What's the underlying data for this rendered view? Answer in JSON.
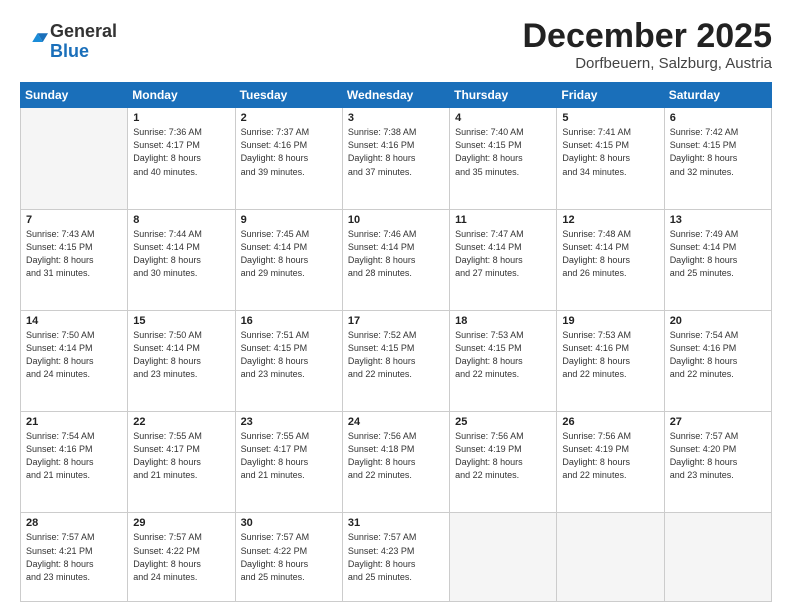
{
  "header": {
    "logo_general": "General",
    "logo_blue": "Blue",
    "month_title": "December 2025",
    "location": "Dorfbeuern, Salzburg, Austria"
  },
  "weekdays": [
    "Sunday",
    "Monday",
    "Tuesday",
    "Wednesday",
    "Thursday",
    "Friday",
    "Saturday"
  ],
  "weeks": [
    [
      {
        "num": "",
        "info": ""
      },
      {
        "num": "1",
        "info": "Sunrise: 7:36 AM\nSunset: 4:17 PM\nDaylight: 8 hours\nand 40 minutes."
      },
      {
        "num": "2",
        "info": "Sunrise: 7:37 AM\nSunset: 4:16 PM\nDaylight: 8 hours\nand 39 minutes."
      },
      {
        "num": "3",
        "info": "Sunrise: 7:38 AM\nSunset: 4:16 PM\nDaylight: 8 hours\nand 37 minutes."
      },
      {
        "num": "4",
        "info": "Sunrise: 7:40 AM\nSunset: 4:15 PM\nDaylight: 8 hours\nand 35 minutes."
      },
      {
        "num": "5",
        "info": "Sunrise: 7:41 AM\nSunset: 4:15 PM\nDaylight: 8 hours\nand 34 minutes."
      },
      {
        "num": "6",
        "info": "Sunrise: 7:42 AM\nSunset: 4:15 PM\nDaylight: 8 hours\nand 32 minutes."
      }
    ],
    [
      {
        "num": "7",
        "info": "Sunrise: 7:43 AM\nSunset: 4:15 PM\nDaylight: 8 hours\nand 31 minutes."
      },
      {
        "num": "8",
        "info": "Sunrise: 7:44 AM\nSunset: 4:14 PM\nDaylight: 8 hours\nand 30 minutes."
      },
      {
        "num": "9",
        "info": "Sunrise: 7:45 AM\nSunset: 4:14 PM\nDaylight: 8 hours\nand 29 minutes."
      },
      {
        "num": "10",
        "info": "Sunrise: 7:46 AM\nSunset: 4:14 PM\nDaylight: 8 hours\nand 28 minutes."
      },
      {
        "num": "11",
        "info": "Sunrise: 7:47 AM\nSunset: 4:14 PM\nDaylight: 8 hours\nand 27 minutes."
      },
      {
        "num": "12",
        "info": "Sunrise: 7:48 AM\nSunset: 4:14 PM\nDaylight: 8 hours\nand 26 minutes."
      },
      {
        "num": "13",
        "info": "Sunrise: 7:49 AM\nSunset: 4:14 PM\nDaylight: 8 hours\nand 25 minutes."
      }
    ],
    [
      {
        "num": "14",
        "info": "Sunrise: 7:50 AM\nSunset: 4:14 PM\nDaylight: 8 hours\nand 24 minutes."
      },
      {
        "num": "15",
        "info": "Sunrise: 7:50 AM\nSunset: 4:14 PM\nDaylight: 8 hours\nand 23 minutes."
      },
      {
        "num": "16",
        "info": "Sunrise: 7:51 AM\nSunset: 4:15 PM\nDaylight: 8 hours\nand 23 minutes."
      },
      {
        "num": "17",
        "info": "Sunrise: 7:52 AM\nSunset: 4:15 PM\nDaylight: 8 hours\nand 22 minutes."
      },
      {
        "num": "18",
        "info": "Sunrise: 7:53 AM\nSunset: 4:15 PM\nDaylight: 8 hours\nand 22 minutes."
      },
      {
        "num": "19",
        "info": "Sunrise: 7:53 AM\nSunset: 4:16 PM\nDaylight: 8 hours\nand 22 minutes."
      },
      {
        "num": "20",
        "info": "Sunrise: 7:54 AM\nSunset: 4:16 PM\nDaylight: 8 hours\nand 22 minutes."
      }
    ],
    [
      {
        "num": "21",
        "info": "Sunrise: 7:54 AM\nSunset: 4:16 PM\nDaylight: 8 hours\nand 21 minutes."
      },
      {
        "num": "22",
        "info": "Sunrise: 7:55 AM\nSunset: 4:17 PM\nDaylight: 8 hours\nand 21 minutes."
      },
      {
        "num": "23",
        "info": "Sunrise: 7:55 AM\nSunset: 4:17 PM\nDaylight: 8 hours\nand 21 minutes."
      },
      {
        "num": "24",
        "info": "Sunrise: 7:56 AM\nSunset: 4:18 PM\nDaylight: 8 hours\nand 22 minutes."
      },
      {
        "num": "25",
        "info": "Sunrise: 7:56 AM\nSunset: 4:19 PM\nDaylight: 8 hours\nand 22 minutes."
      },
      {
        "num": "26",
        "info": "Sunrise: 7:56 AM\nSunset: 4:19 PM\nDaylight: 8 hours\nand 22 minutes."
      },
      {
        "num": "27",
        "info": "Sunrise: 7:57 AM\nSunset: 4:20 PM\nDaylight: 8 hours\nand 23 minutes."
      }
    ],
    [
      {
        "num": "28",
        "info": "Sunrise: 7:57 AM\nSunset: 4:21 PM\nDaylight: 8 hours\nand 23 minutes."
      },
      {
        "num": "29",
        "info": "Sunrise: 7:57 AM\nSunset: 4:22 PM\nDaylight: 8 hours\nand 24 minutes."
      },
      {
        "num": "30",
        "info": "Sunrise: 7:57 AM\nSunset: 4:22 PM\nDaylight: 8 hours\nand 25 minutes."
      },
      {
        "num": "31",
        "info": "Sunrise: 7:57 AM\nSunset: 4:23 PM\nDaylight: 8 hours\nand 25 minutes."
      },
      {
        "num": "",
        "info": ""
      },
      {
        "num": "",
        "info": ""
      },
      {
        "num": "",
        "info": ""
      }
    ]
  ]
}
